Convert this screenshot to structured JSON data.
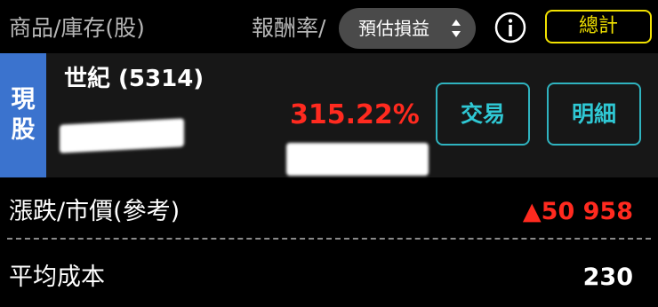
{
  "header": {
    "product_label": "商品/庫存(股)",
    "rate_label": "報酬率/",
    "dropdown_value": "預估損益",
    "total_button": "總計"
  },
  "holding": {
    "type_tag_line1": "現",
    "type_tag_line2": "股",
    "stock_name": "世紀 (5314)",
    "return_rate": "315.22%",
    "trade_button": "交易",
    "detail_button": "明細"
  },
  "details": {
    "change_label": "漲跌/市價(參考)",
    "change_value": "▲50 958",
    "avg_cost_label": "平均成本",
    "avg_cost_value": "230"
  },
  "colors": {
    "accent_teal": "#2fb3bf",
    "total_yellow": "#f2e200",
    "loss_gain_red": "#ff2a1f",
    "tag_blue": "#3b73ce"
  },
  "icons": {
    "info": "info-circle-icon",
    "sort": "sort-updown-icon"
  }
}
